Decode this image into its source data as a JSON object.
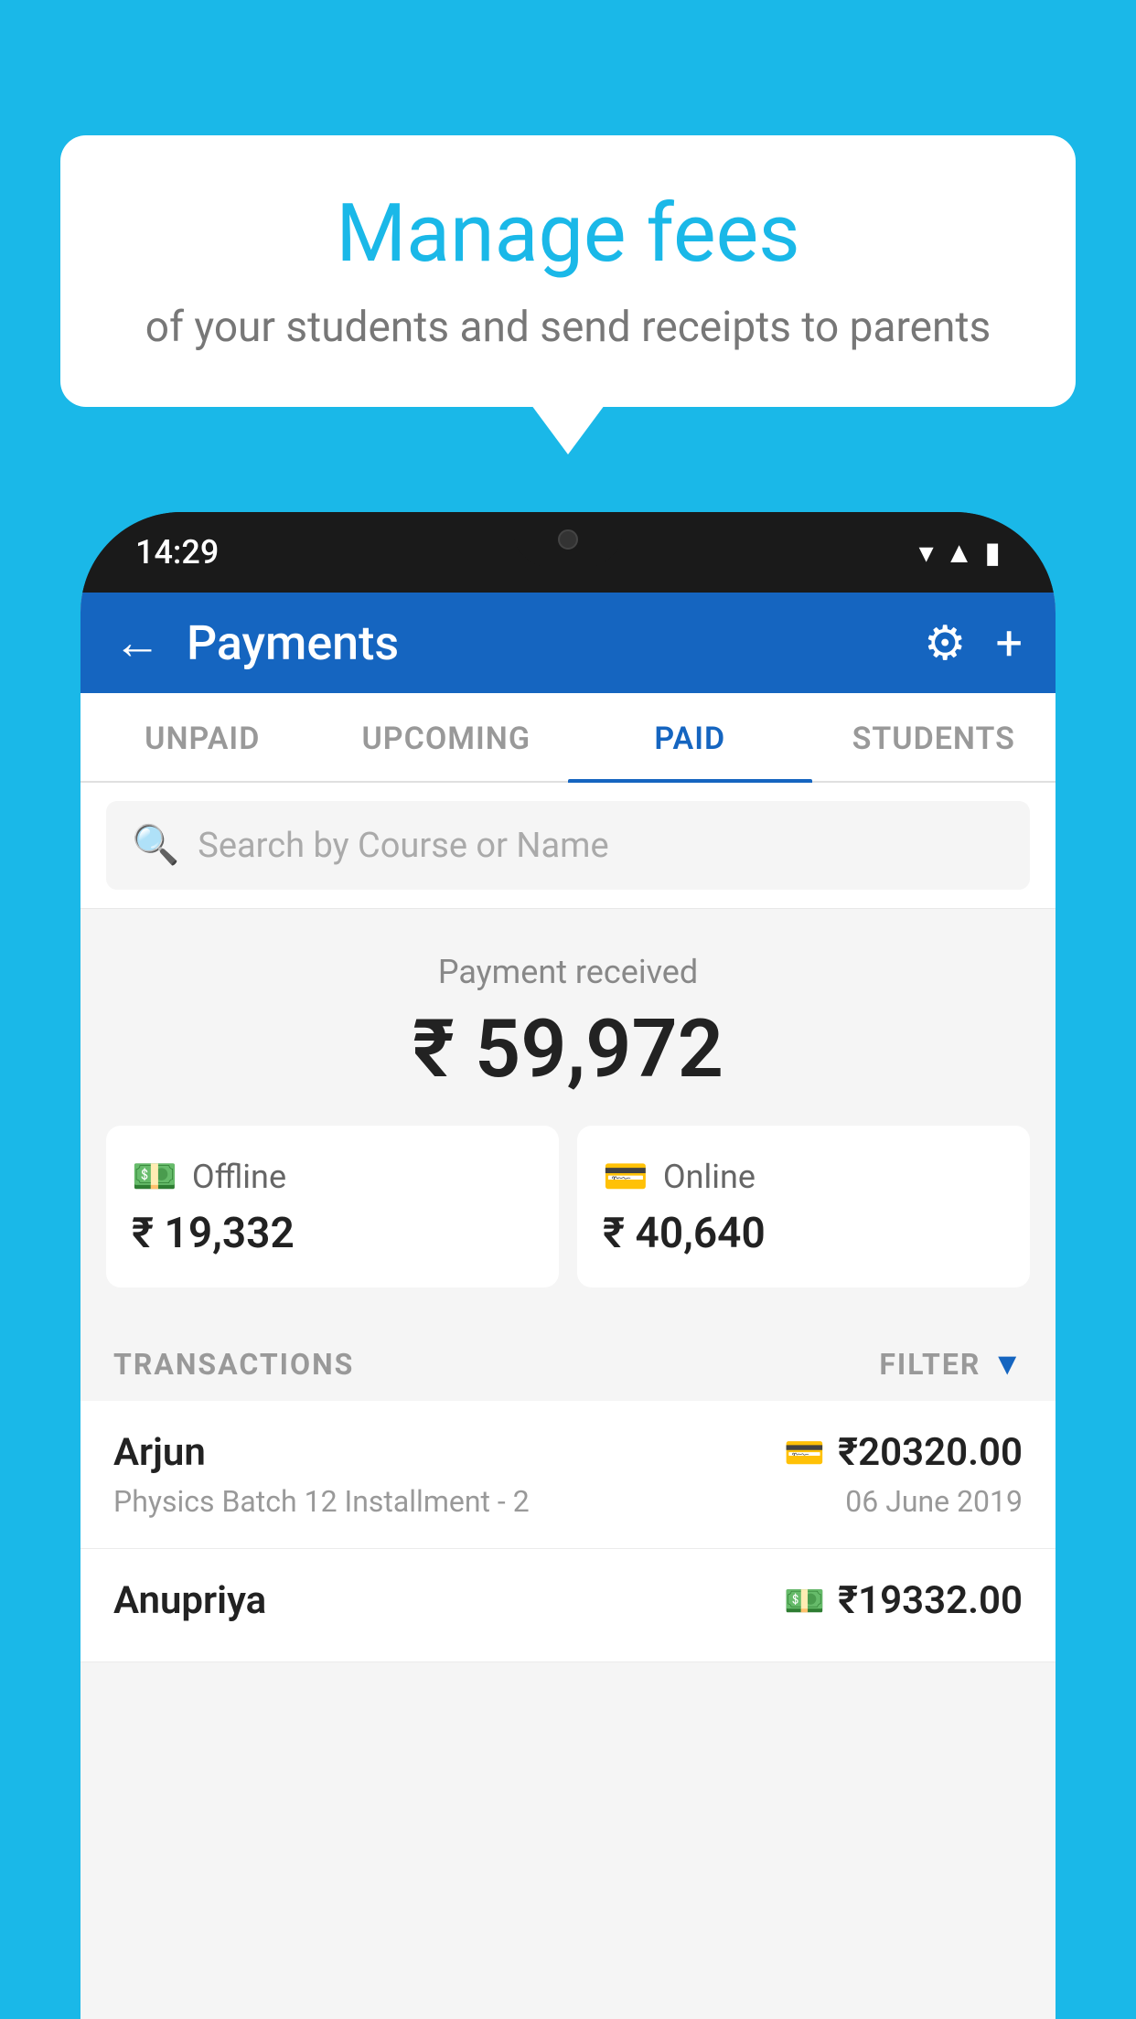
{
  "background_color": "#1ab8e8",
  "bubble": {
    "title": "Manage fees",
    "subtitle": "of your students and send receipts to parents"
  },
  "status_bar": {
    "time": "14:29"
  },
  "header": {
    "title": "Payments",
    "back_label": "←",
    "settings_icon": "⚙",
    "add_icon": "+"
  },
  "tabs": [
    {
      "label": "UNPAID",
      "active": false
    },
    {
      "label": "UPCOMING",
      "active": false
    },
    {
      "label": "PAID",
      "active": true
    },
    {
      "label": "STUDENTS",
      "active": false
    }
  ],
  "search": {
    "placeholder": "Search by Course or Name"
  },
  "payment_summary": {
    "received_label": "Payment received",
    "total_amount": "₹ 59,972",
    "offline_label": "Offline",
    "offline_amount": "₹ 19,332",
    "online_label": "Online",
    "online_amount": "₹ 40,640"
  },
  "transactions": {
    "section_label": "TRANSACTIONS",
    "filter_label": "FILTER",
    "rows": [
      {
        "name": "Arjun",
        "detail": "Physics Batch 12 Installment - 2",
        "amount": "₹20320.00",
        "date": "06 June 2019",
        "payment_type": "online"
      },
      {
        "name": "Anupriya",
        "detail": "",
        "amount": "₹19332.00",
        "date": "",
        "payment_type": "offline"
      }
    ]
  }
}
